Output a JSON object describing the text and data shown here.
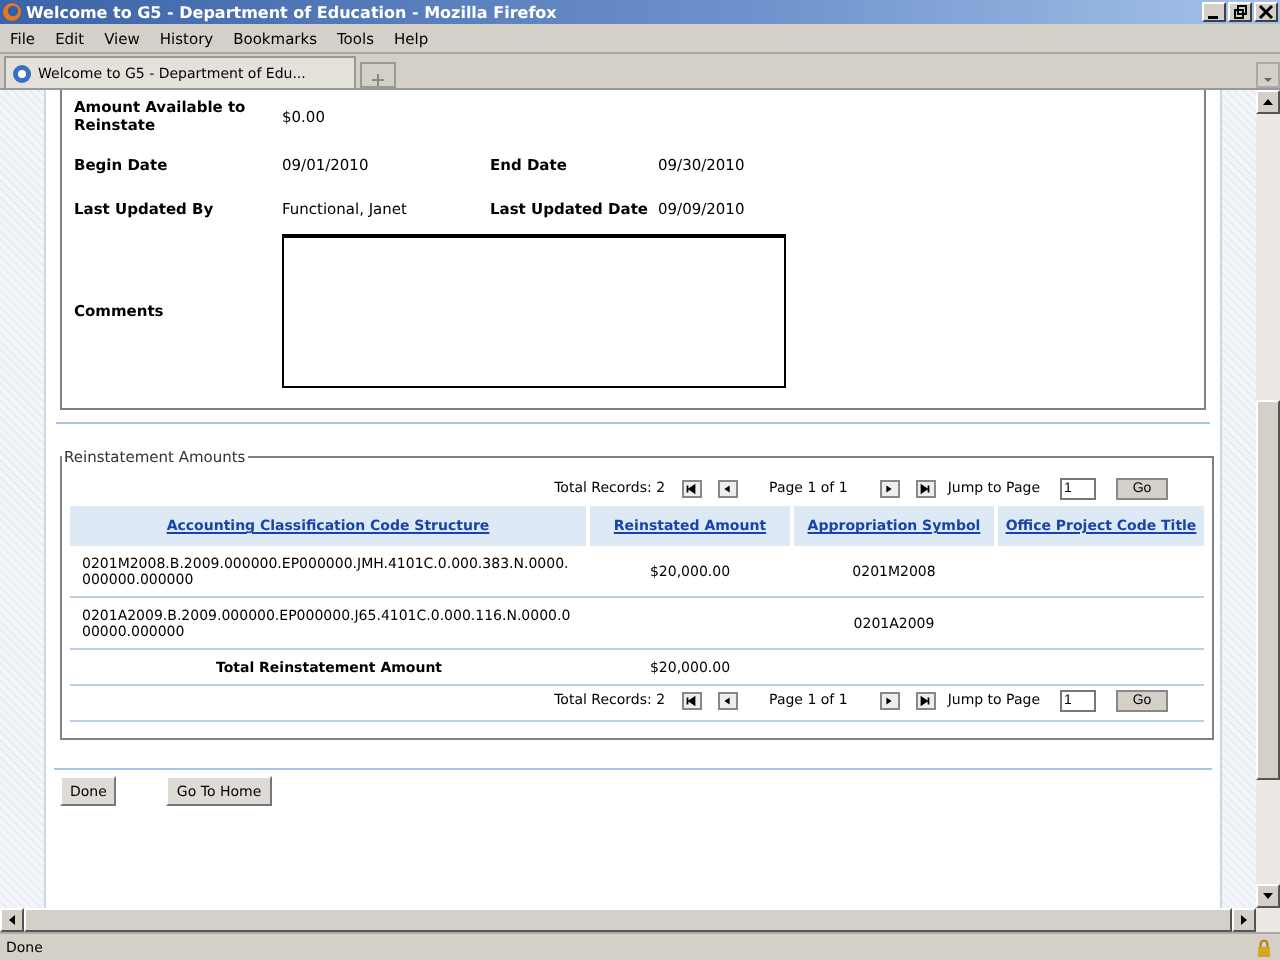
{
  "window": {
    "title": "Welcome to G5 - Department of Education - Mozilla Firefox"
  },
  "menu": [
    "File",
    "Edit",
    "View",
    "History",
    "Bookmarks",
    "Tools",
    "Help"
  ],
  "tabs": [
    {
      "label": "Welcome to G5 - Department of Edu...",
      "selected": true
    }
  ],
  "details": [
    {
      "label": "Amount Available to Reinstate",
      "value": "$0.00"
    },
    {
      "label": "Begin Date",
      "value": "09/01/2010",
      "label2": "End Date",
      "value2": "09/30/2010"
    },
    {
      "label": "Last Updated By",
      "value": "Functional, Janet",
      "label2": "Last Updated Date",
      "value2": "09/09/2010"
    }
  ],
  "comments": {
    "label": "Comments"
  },
  "reinstatement": {
    "legend": "Reinstatement Amounts",
    "pagers": [
      {
        "total": "Total Records: 2",
        "page": "Page 1 of 1",
        "jump": "Jump to Page",
        "value": "1",
        "go": "Go"
      },
      {
        "total": "Total Records: 2",
        "page": "Page 1 of 1",
        "jump": "Jump to Page",
        "value": "1",
        "go": "Go"
      }
    ],
    "columns": [
      "Accounting Classification Code Structure",
      "Reinstated Amount",
      "Appropriation Symbol",
      "Office Project Code Title"
    ],
    "rows": [
      {
        "code": "0201M2008.B.2009.000000.EP000000.JMH.4101C.0.000.383.N.0000.000000.000000",
        "amount": "$20,000.00",
        "symbol": "0201M2008"
      },
      {
        "code": "0201A2009.B.2009.000000.EP000000.J65.4101C.0.000.116.N.0000.000000.000000",
        "symbol": "0201A2009"
      }
    ],
    "total_label": "Total Reinstatement Amount",
    "total_value": "$20,000.00"
  },
  "buttons": [
    "Done",
    "Go To Home"
  ],
  "status_bar": "Done"
}
